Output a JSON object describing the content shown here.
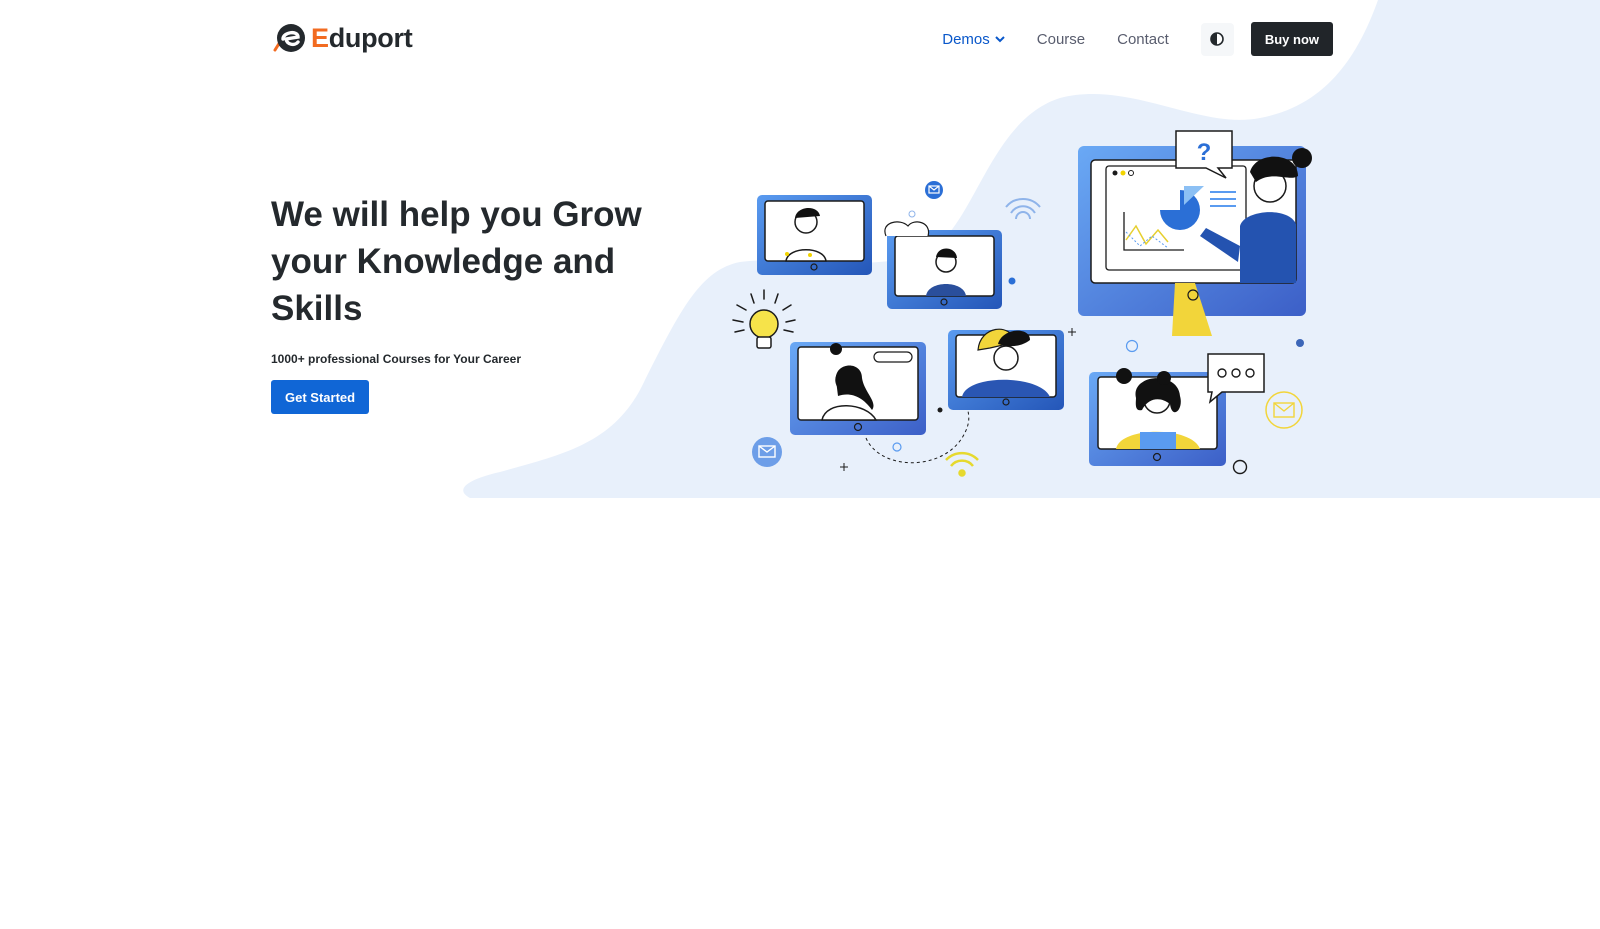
{
  "brand": {
    "name_first": "E",
    "name_rest": "duport",
    "accent_color": "#f26b21",
    "logo_icon": "eduport-logo-icon"
  },
  "nav": {
    "items": [
      {
        "label": "Demos",
        "active": true,
        "dropdown": true
      },
      {
        "label": "Course",
        "active": false,
        "dropdown": false
      },
      {
        "label": "Contact",
        "active": false,
        "dropdown": false
      }
    ],
    "theme_icon": "half-circle-contrast-icon",
    "buy_label": "Buy now"
  },
  "hero": {
    "title": "We will help you Grow your Knowledge and Skills",
    "subtitle": "1000+ professional Courses for Your Career",
    "cta_label": "Get Started",
    "primary_color": "#1066d6",
    "bg_color": "#e8f0fb"
  },
  "illustration": {
    "bubble_question": "?"
  }
}
